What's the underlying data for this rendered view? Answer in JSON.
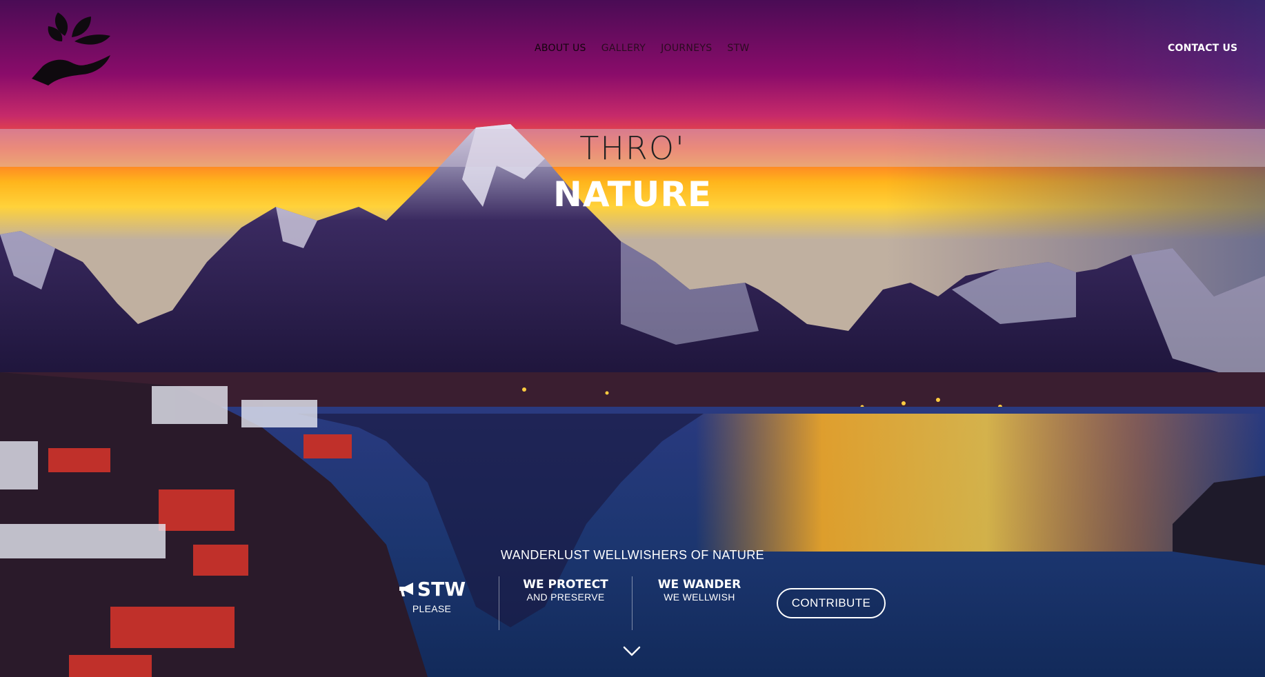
{
  "nav": {
    "items": [
      "ABOUT US",
      "GALLERY",
      "JOURNEYS",
      "STW"
    ],
    "contact": "CONTACT US"
  },
  "hero": {
    "title_top": "THRO'",
    "title_main": "NATURE",
    "tagline": "WANDERLUST WELLWISHERS OF NATURE"
  },
  "stats": {
    "stw_title": "STW",
    "stw_sub": "PLEASE",
    "protect_title": "WE PROTECT",
    "protect_sub": "AND PRESERVE",
    "wander_title": "WE WANDER",
    "wander_sub": "WE WELLWISH"
  },
  "cta": {
    "contribute": "CONTRIBUTE"
  },
  "icons": {
    "logo": "hand-leaves-icon",
    "megaphone": "megaphone-icon",
    "scroll": "chevron-down-icon"
  },
  "colors": {
    "sky_top": "#6a0a5a",
    "sky_glow": "#ff9a1a",
    "water": "#1c3d7a",
    "white": "#ffffff"
  }
}
